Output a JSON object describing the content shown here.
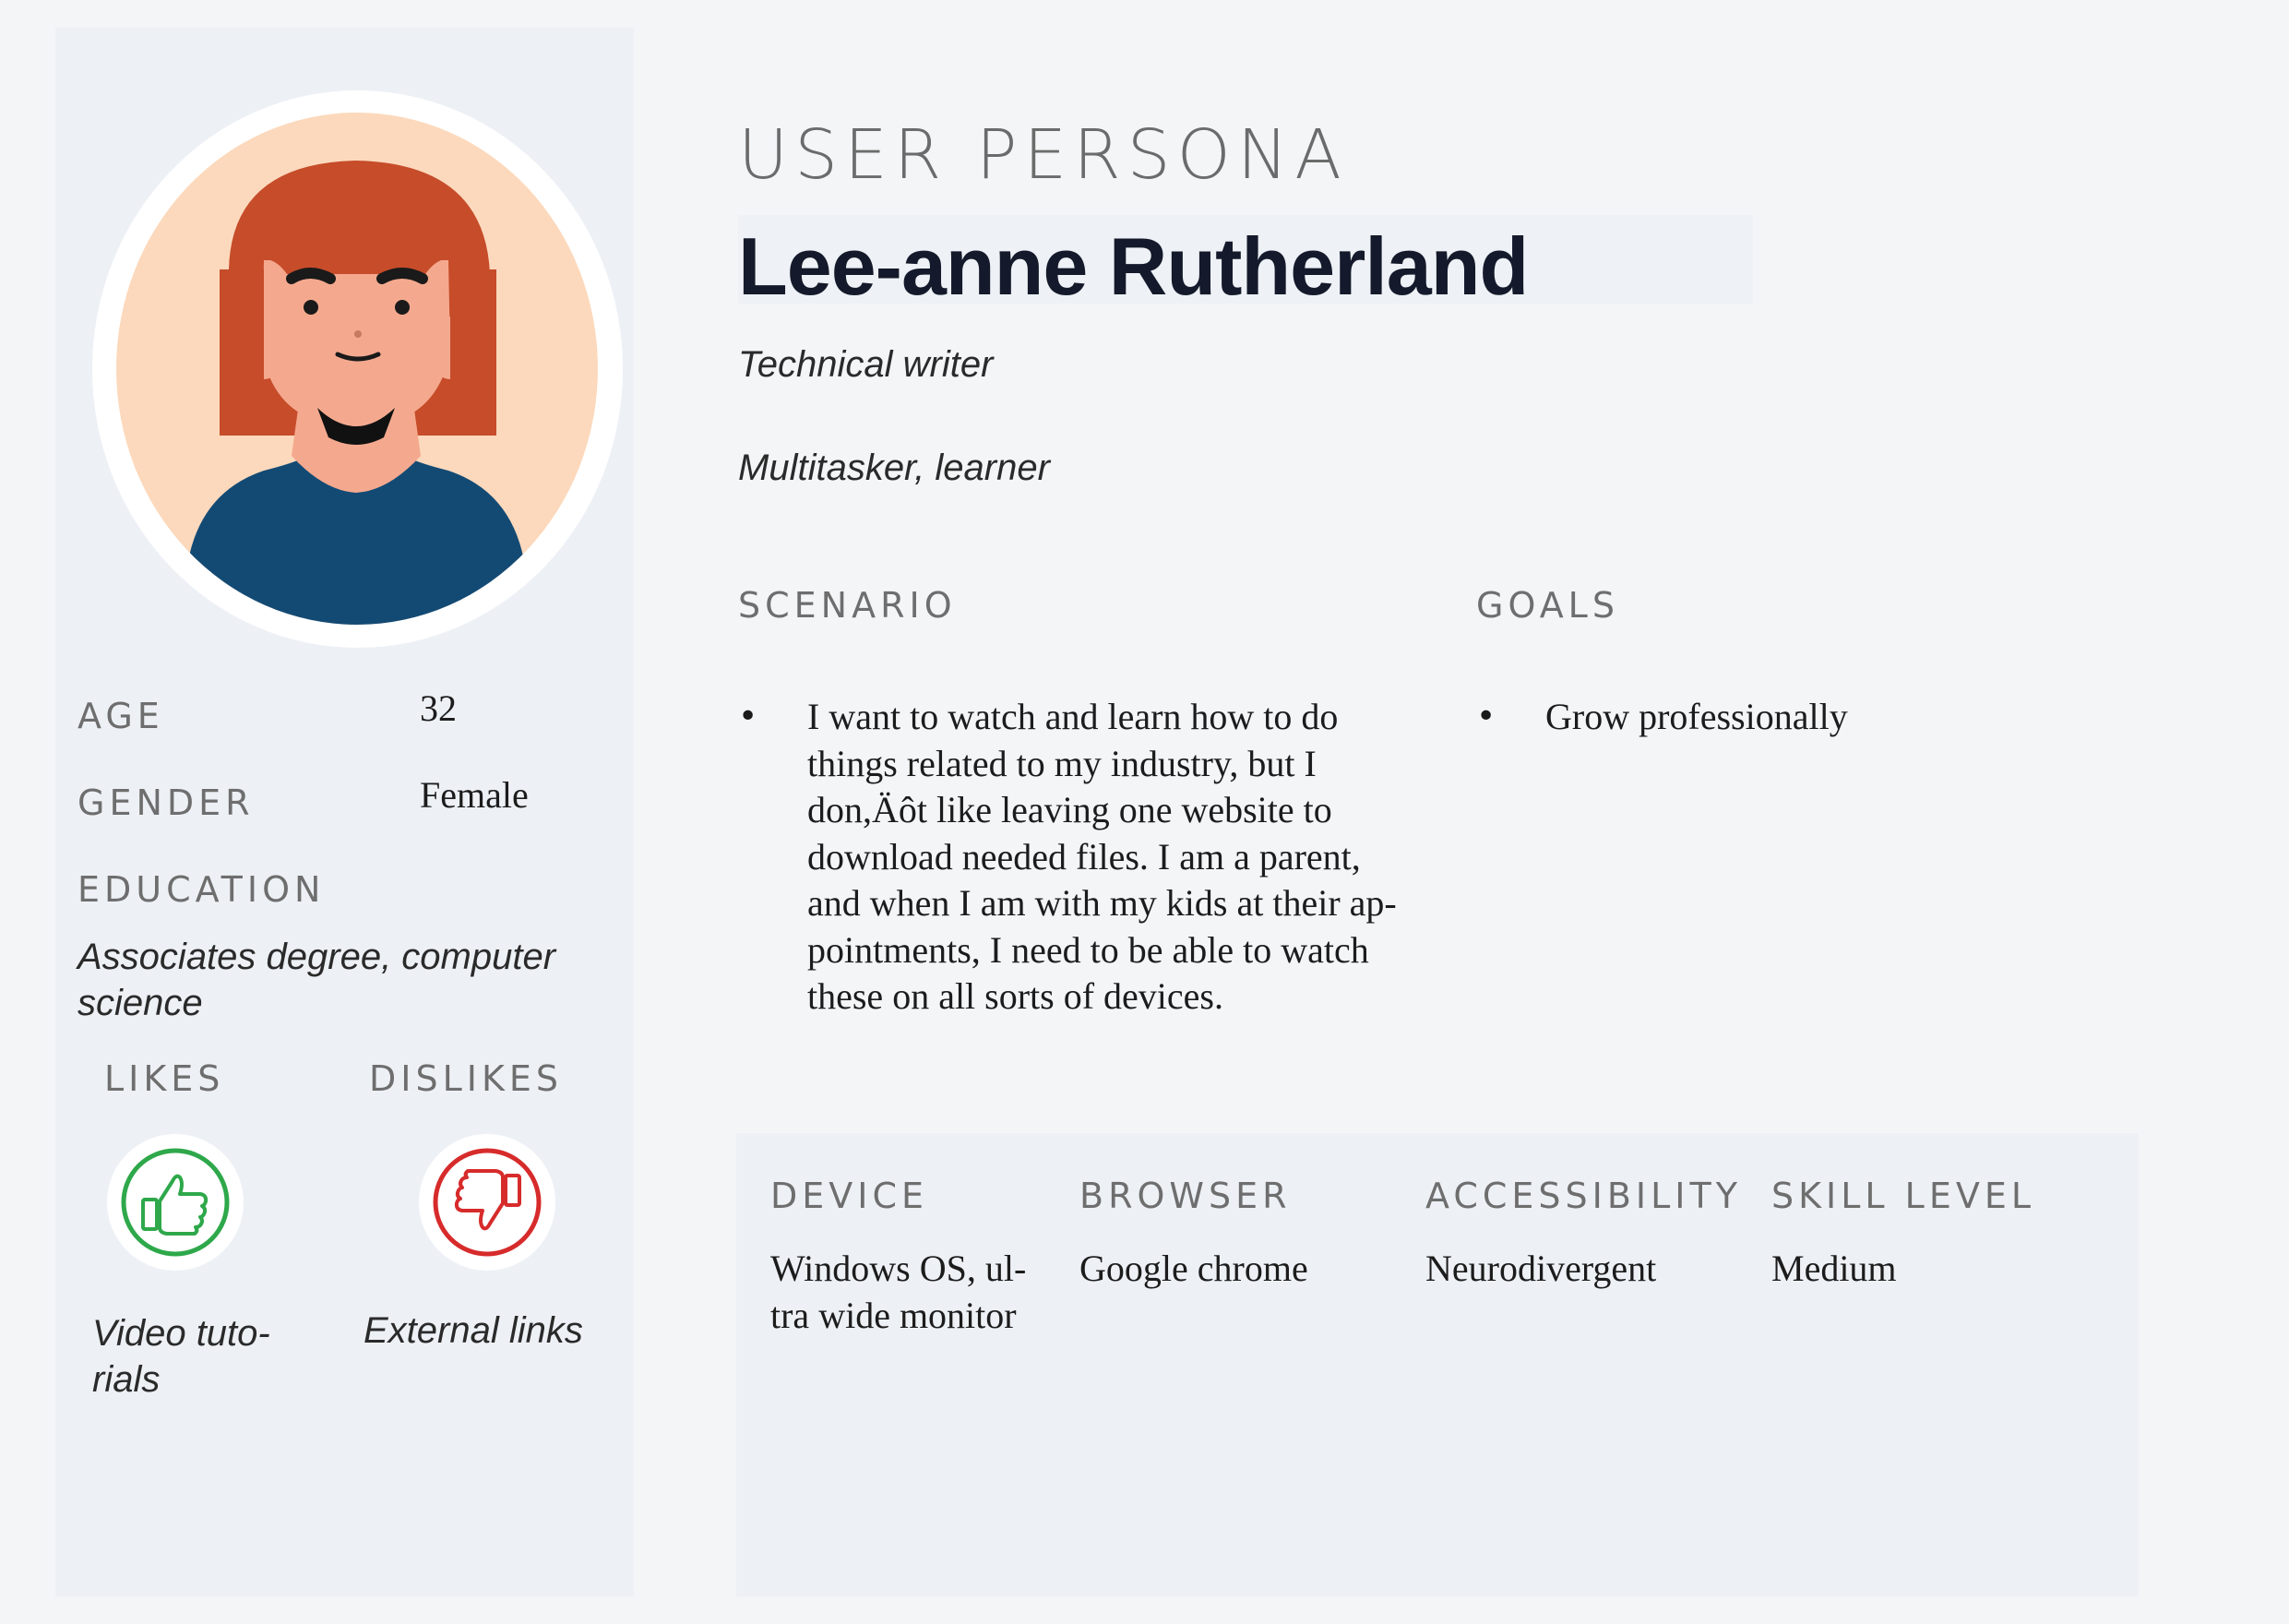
{
  "header": {
    "section_label": "USER PERSONA",
    "name": "Lee-anne Rutherland",
    "job_title": "Technical writer",
    "traits": "Multitasker, learner"
  },
  "profile": {
    "age_label": "AGE",
    "age_value": "32",
    "gender_label": "GENDER",
    "gender_value": "Female",
    "education_label": "EDUCATION",
    "education_line1": "Associates degree, computer",
    "education_line2": "science"
  },
  "likes": {
    "likes_label": "LIKES",
    "dislikes_label": "DISLIKES",
    "like_icon": "thumbs-up-icon",
    "dislike_icon": "thumbs-down-icon",
    "like_line1": "Video tuto-",
    "like_line2": "rials",
    "dislike_text": "External links",
    "like_color": "#2ea84a",
    "dislike_color": "#d72b2b"
  },
  "scenario": {
    "label": "SCENARIO",
    "lines": [
      "I want to watch and learn how to do",
      "things related to my industry, but I",
      "don,Äôt like leaving one website to",
      "download needed files. I am a parent,",
      "and when I am with my kids at their ap-",
      "pointments, I need to be able to watch",
      "these on all sorts of devices."
    ]
  },
  "goals": {
    "label": "GOALS",
    "items": [
      "Grow professionally"
    ]
  },
  "info": {
    "device_label": "DEVICE",
    "device_line1": "Windows OS, ul-",
    "device_line2": "tra wide monitor",
    "browser_label": "BROWSER",
    "browser_value": "Google chrome",
    "accessibility_label": "ACCESSIBILITY",
    "accessibility_value": "Neurodivergent",
    "skill_label": "SKILL LEVEL",
    "skill_value": "Medium"
  },
  "colors": {
    "page_bg": "#f3f5f7",
    "panel_bg": "#edf1f6",
    "hair": "#c64c2a",
    "skin": "#f4a98e",
    "shirt": "#134a74"
  }
}
